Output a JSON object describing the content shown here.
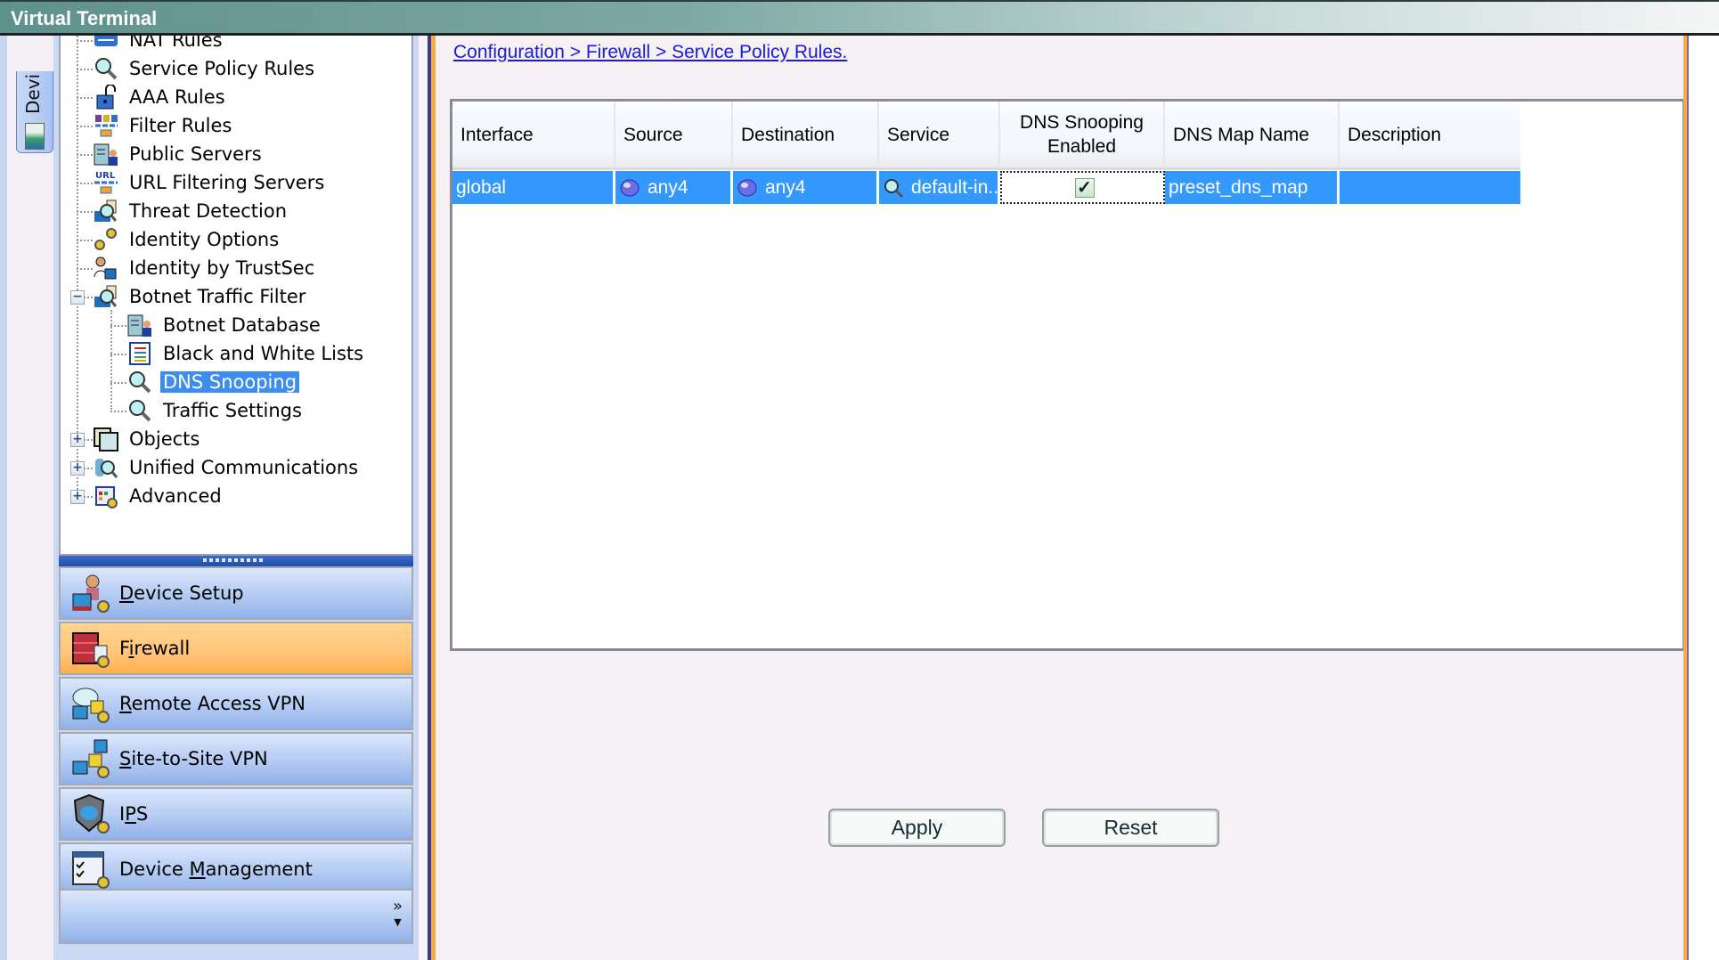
{
  "window": {
    "title": "Virtual Terminal"
  },
  "left_tab": {
    "label": "Devi"
  },
  "tree": {
    "items": [
      {
        "label": "NAT Rules",
        "icon": "nat-rules-icon",
        "level": 1
      },
      {
        "label": "Service Policy Rules",
        "icon": "magnifier-icon",
        "level": 1
      },
      {
        "label": "AAA Rules",
        "icon": "padlock-icon",
        "level": 1
      },
      {
        "label": "Filter Rules",
        "icon": "filter-icon",
        "level": 1
      },
      {
        "label": "Public Servers",
        "icon": "server-user-icon",
        "level": 1
      },
      {
        "label": "URL Filtering Servers",
        "icon": "url-filter-icon",
        "level": 1
      },
      {
        "label": "Threat Detection",
        "icon": "threat-detection-icon",
        "level": 1
      },
      {
        "label": "Identity Options",
        "icon": "gears-icon",
        "level": 1
      },
      {
        "label": "Identity by TrustSec",
        "icon": "user-lock-icon",
        "level": 1
      },
      {
        "label": "Botnet Traffic Filter",
        "icon": "threat-detection-icon",
        "level": 1,
        "expander": "-"
      },
      {
        "label": "Botnet Database",
        "icon": "server-user-icon",
        "level": 2
      },
      {
        "label": "Black and White Lists",
        "icon": "list-icon",
        "level": 2
      },
      {
        "label": "DNS Snooping",
        "icon": "magnifier-icon",
        "level": 2,
        "selected": true
      },
      {
        "label": "Traffic Settings",
        "icon": "magnifier-icon",
        "level": 2
      },
      {
        "label": "Objects",
        "icon": "objects-icon",
        "level": 1,
        "expander": "+"
      },
      {
        "label": "Unified Communications",
        "icon": "phone-magnifier-icon",
        "level": 1,
        "expander": "+"
      },
      {
        "label": "Advanced",
        "icon": "advanced-icon",
        "level": 1,
        "expander": "+"
      }
    ]
  },
  "nav_buttons": [
    {
      "label": "Device Setup",
      "mnemonic_index": 0,
      "icon": "device-setup-icon",
      "active": false
    },
    {
      "label": "Firewall",
      "mnemonic_index": 1,
      "icon": "firewall-icon",
      "active": true
    },
    {
      "label": "Remote Access VPN",
      "mnemonic_index": 0,
      "icon": "remote-vpn-icon",
      "active": false
    },
    {
      "label": "Site-to-Site VPN",
      "mnemonic_index": 0,
      "icon": "site-vpn-icon",
      "active": false
    },
    {
      "label": "IPS",
      "mnemonic_index": 1,
      "icon": "ips-shield-icon",
      "active": false
    },
    {
      "label": "Device Management",
      "mnemonic_index": 7,
      "icon": "device-management-icon",
      "active": false
    }
  ],
  "nav_more": {
    "glyph": "»"
  },
  "main": {
    "breadcrumb": "Configuration > Firewall > Service Policy Rules",
    "breadcrumb_suffix": ".",
    "table": {
      "columns": [
        "Interface",
        "Source",
        "Destination",
        "Service",
        "DNS Snooping Enabled",
        "DNS Map Name",
        "Description"
      ],
      "rows": [
        {
          "interface": "global",
          "source": "any4",
          "destination": "any4",
          "service": "default-in...",
          "dns_snooping_enabled": true,
          "dns_map_name": "preset_dns_map",
          "description": ""
        }
      ]
    },
    "buttons": {
      "apply": "Apply",
      "reset": "Reset"
    }
  },
  "colors": {
    "selection": "#3399ff",
    "active_nav": "#ffc57a",
    "link": "#1a1adb"
  }
}
